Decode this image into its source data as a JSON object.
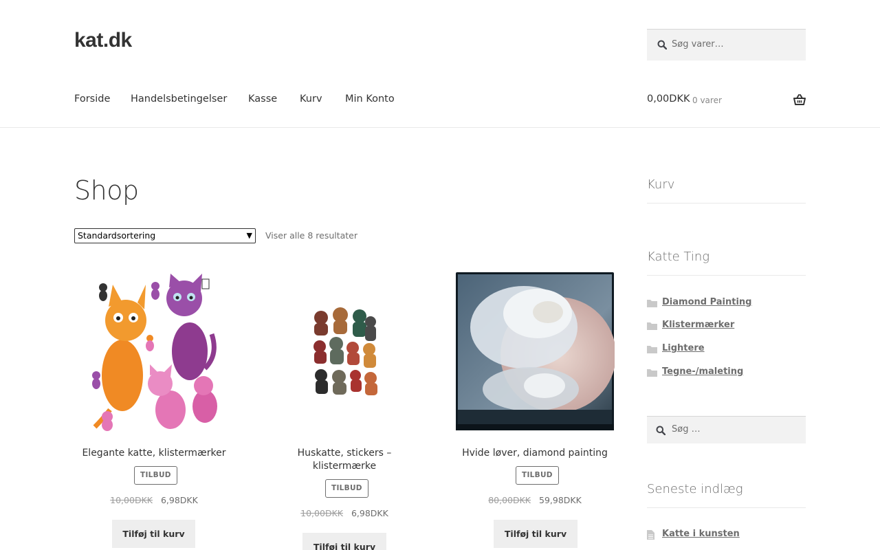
{
  "site": {
    "logo": "kat.dk"
  },
  "header_search": {
    "placeholder": "Søg varer…",
    "icon": "search-icon"
  },
  "nav": {
    "items": [
      {
        "label": "Forside"
      },
      {
        "label": "Handelsbetingelser"
      },
      {
        "label": "Kasse"
      },
      {
        "label": "Kurv"
      },
      {
        "label": "Min Konto"
      }
    ]
  },
  "cart_summary": {
    "amount": "0,00DKK",
    "count": "0 varer",
    "icon": "basket-icon"
  },
  "main": {
    "title": "Shop",
    "sort": {
      "selected": "Standardsortering"
    },
    "result_count": "Viser alle 8 resultater"
  },
  "products": [
    {
      "title": "Elegante katte, klistermærker",
      "badge": "TILBUD",
      "old_price": "10,00DKK",
      "new_price": "6,98DKK",
      "button": "Tilføj til kurv"
    },
    {
      "title": "Huskatte, stickers – klistermærke",
      "badge": "TILBUD",
      "old_price": "10,00DKK",
      "new_price": "6,98DKK",
      "button": "Tilføj til kurv"
    },
    {
      "title": "Hvide løver, diamond painting",
      "badge": "TILBUD",
      "old_price": "80,00DKK",
      "new_price": "59,98DKK",
      "button": "Tilføj til kurv"
    }
  ],
  "sidebar": {
    "cart_title": "Kurv",
    "categories_title": "Katte Ting",
    "categories": [
      {
        "label": "Diamond Painting"
      },
      {
        "label": "Klistermærker"
      },
      {
        "label": "Lightere"
      },
      {
        "label": "Tegne-/maleting"
      }
    ],
    "search_placeholder": "Søg …",
    "recent_title": "Seneste indlæg",
    "recent_posts": [
      {
        "label": "Katte i kunsten"
      }
    ]
  },
  "colors": {
    "text": "#43454b",
    "muted": "#6d6d6d",
    "button_bg": "#eeeeee",
    "search_bg": "#f2f2f2"
  }
}
